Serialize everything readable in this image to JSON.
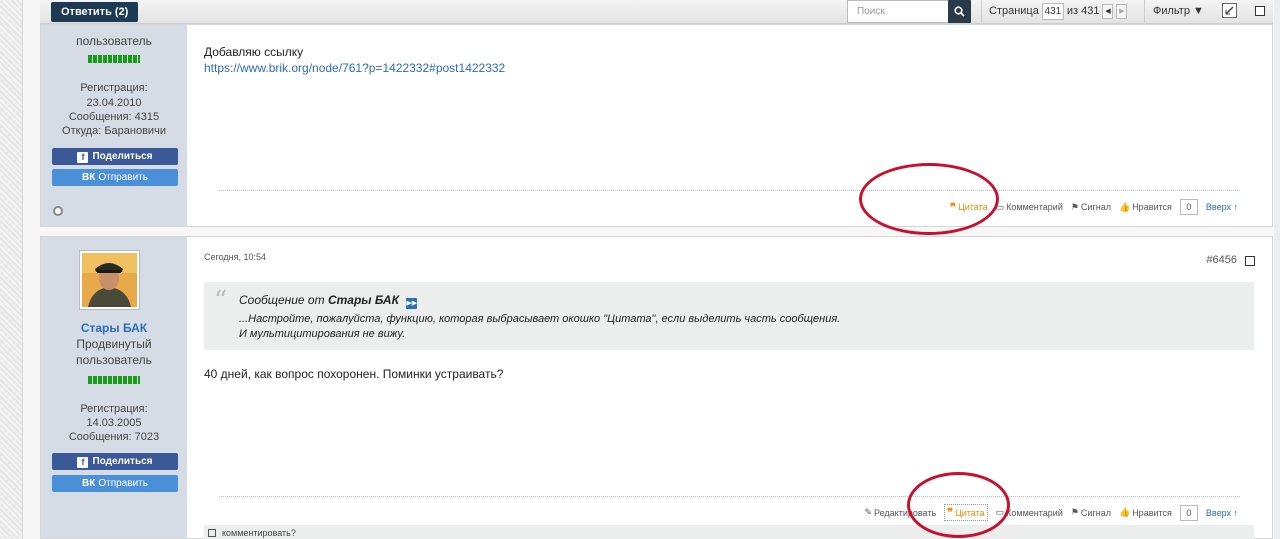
{
  "toolbar": {
    "reply_label": "Ответить (2)",
    "search_placeholder": "Поиск",
    "page_prefix": "Страница",
    "page_current": "431",
    "page_of": "из 431",
    "filter_label": "Фильтр ▼"
  },
  "post1": {
    "user_rank": "пользователь",
    "reg_label": "Регистрация:",
    "reg_date": "23.04.2010",
    "messages": "Сообщения: 4315",
    "from": "Откуда: Барановичи",
    "share_fb": "Поделиться",
    "share_vk": "Отправить",
    "text": "Добавляю ссылку",
    "link": "https://www.brik.org/node/761?p=1422332#post1422332",
    "actions": {
      "quote": "Цитата",
      "comment": "Комментарий",
      "report": "Сигнал",
      "like": "Нравится",
      "like_count": "0",
      "top": "Вверх ↑"
    }
  },
  "post2": {
    "username": "Стары БАК",
    "user_rank": "Продвинутый пользователь",
    "reg_label": "Регистрация:",
    "reg_date": "14.03.2005",
    "messages": "Сообщения: 7023",
    "share_fb": "Поделиться",
    "share_vk": "Отправить",
    "date": "Сегодня, 10:54",
    "post_number": "#6456",
    "quote_prefix": "Сообщение от",
    "quote_author": "Стары БАК",
    "quote_line1": "...Настройте, пожалуйста, функцию, которая выбрасывает окошко \"Цитата\", если выделить часть сообщения.",
    "quote_line2": "И мультицитирования не вижу.",
    "text": "40 дней, как вопрос похоронен. Поминки устраивать?",
    "actions": {
      "edit": "Редактировать",
      "quote": "Цитата",
      "comment": "Комментарий",
      "report": "Сигнал",
      "like": "Нравится",
      "like_count": "0",
      "top": "Вверх ↑"
    },
    "comment_footer": "комментировать?"
  },
  "colors": {
    "accent_dark": "#1d3a55",
    "link": "#2a6ebb",
    "quote_orange": "#f08a00",
    "highlight_red": "#c8102e",
    "userinfo_bg": "#d5dce5"
  }
}
